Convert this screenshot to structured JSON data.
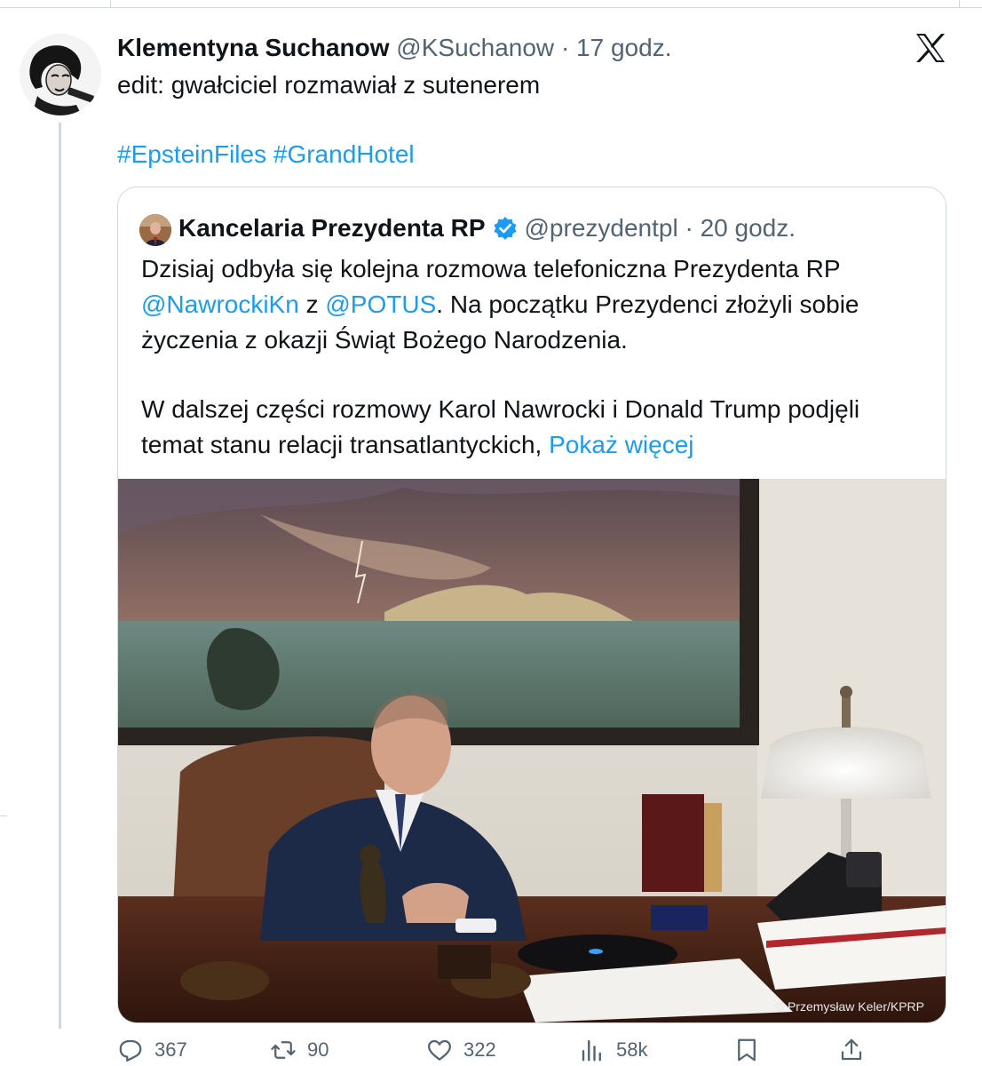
{
  "tweet": {
    "author": {
      "name": "Klementyna Suchanow",
      "handle": "@KSuchanow",
      "separator": "·",
      "time": "17 godz.",
      "avatar_icon": "profile-photo"
    },
    "text": "edit: gwałciciel rozmawiał z sutenerem",
    "hashtags": [
      "#EpsteinFiles",
      "#GrandHotel"
    ],
    "platform_icon": "x-logo-icon"
  },
  "quote": {
    "author": {
      "name": "Kancelaria Prezydenta RP",
      "handle": "@prezydentpl",
      "separator": "·",
      "time": "20 godz.",
      "verified_icon": "verified-badge-icon"
    },
    "line1": "Dzisiaj odbyła się kolejna rozmowa telefoniczna Prezydenta RP",
    "mention1": "@NawrockiKn",
    "conj": "z",
    "mention2": "@POTUS",
    "line2_rest": ". Na początku Prezydenci złożyli sobie",
    "line3": "życzenia z okazji Świąt Bożego Narodzenia.",
    "line4": "W dalszej części rozmowy Karol Nawrocki i Donald Trump podjęli",
    "line5": "temat stanu relacji transatlantyckich,",
    "show_more": "Pokaż więcej",
    "photo_credit": "© Przemysław Keler/KPRP"
  },
  "actions": {
    "replies": "367",
    "reposts": "90",
    "likes": "322",
    "views": "58k"
  },
  "colors": {
    "link": "#1d9bf0",
    "muted": "#536471",
    "text": "#0f1419",
    "border": "#cfd9de"
  }
}
